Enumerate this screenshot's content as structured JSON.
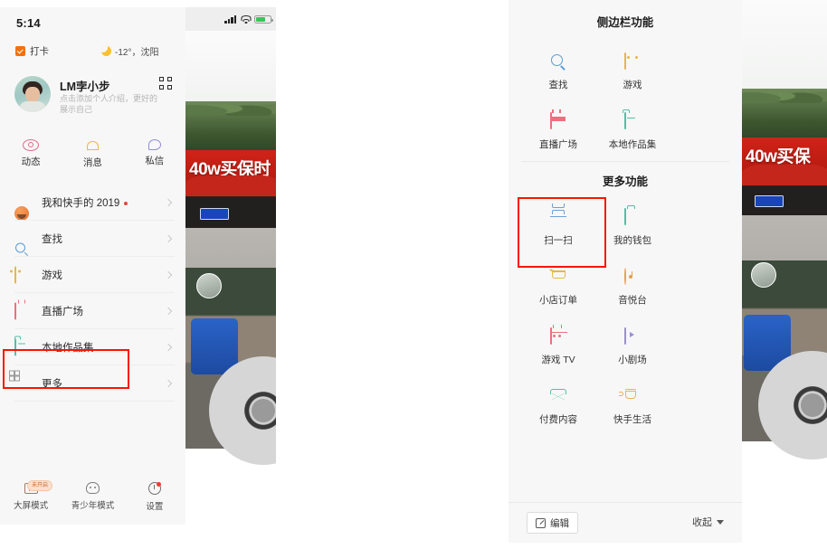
{
  "left_screenshot": {
    "status_bar": {
      "time": "5:14"
    },
    "top_row": {
      "checkin_label": "打卡",
      "weather_text": "-12°，沈阳"
    },
    "profile": {
      "username": "LM孛小步",
      "bio": "点击添加个人介绍，更好的展示自己",
      "qr_icon": "qr-code-icon"
    },
    "quick_actions": [
      {
        "label": "动态",
        "icon": "eye-icon"
      },
      {
        "label": "消息",
        "icon": "bell-icon"
      },
      {
        "label": "私信",
        "icon": "chat-bubble-icon"
      }
    ],
    "menu_items": [
      {
        "label": "我和快手的 2019",
        "icon": "pumpkin-icon",
        "dot": true
      },
      {
        "label": "查找",
        "icon": "search-icon",
        "dot": false
      },
      {
        "label": "游戏",
        "icon": "game-icon",
        "dot": false
      },
      {
        "label": "直播广场",
        "icon": "live-icon",
        "dot": false
      },
      {
        "label": "本地作品集",
        "icon": "folder-icon",
        "dot": false
      },
      {
        "label": "更多",
        "icon": "grid-icon",
        "dot": false
      }
    ],
    "bottom_bar": [
      {
        "label": "大屏模式",
        "icon": "big-screen-icon",
        "badge": "未开启"
      },
      {
        "label": "青少年模式",
        "icon": "teen-mode-icon",
        "badge": ""
      },
      {
        "label": "设置",
        "icon": "gear-icon",
        "badge": ""
      }
    ],
    "video_overlay_text": "40w买保时"
  },
  "right_screenshot": {
    "sidebar_section_title": "侧边栏功能",
    "sidebar_items": [
      {
        "label": "查找",
        "icon": "search-icon"
      },
      {
        "label": "游戏",
        "icon": "game-icon"
      },
      {
        "label": "直播广场",
        "icon": "live-icon"
      },
      {
        "label": "本地作品集",
        "icon": "folder-icon"
      }
    ],
    "more_section_title": "更多功能",
    "more_items": [
      {
        "label": "扫一扫",
        "icon": "scan-icon"
      },
      {
        "label": "我的钱包",
        "icon": "wallet-icon"
      },
      {
        "label": "小店订单",
        "icon": "cart-icon"
      },
      {
        "label": "音悦台",
        "icon": "music-icon"
      },
      {
        "label": "游戏 TV",
        "icon": "game-tv-icon"
      },
      {
        "label": "小剧场",
        "icon": "theater-icon"
      },
      {
        "label": "付费内容",
        "icon": "diamond-icon"
      },
      {
        "label": "快手生活",
        "icon": "cup-icon"
      }
    ],
    "footer": {
      "edit_label": "编辑",
      "collapse_label": "收起"
    },
    "video_overlay_text": "40w买保"
  },
  "annotations": {
    "highlight_color": "#fa1400",
    "boxes": [
      {
        "target": "更多"
      },
      {
        "target": "扫一扫"
      }
    ]
  }
}
